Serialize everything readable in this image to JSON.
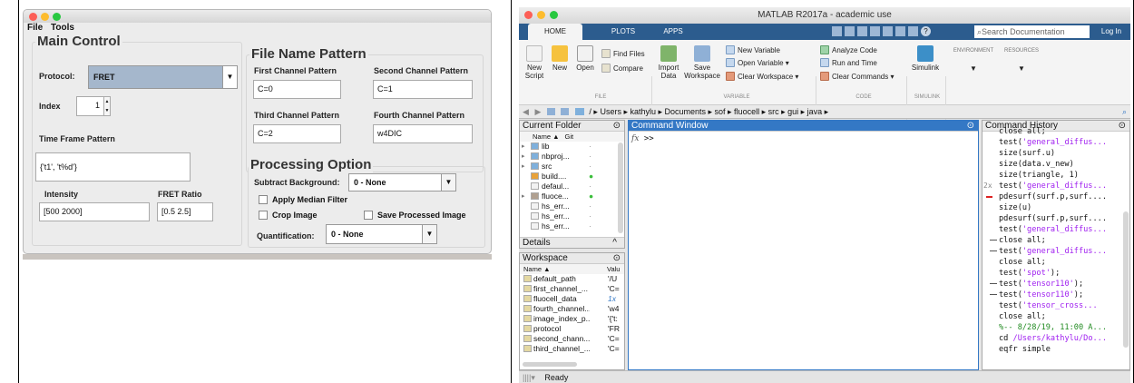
{
  "left_app": {
    "menu": [
      "File",
      "Tools"
    ],
    "main_control": {
      "title": "Main Control",
      "protocol_label": "Protocol:",
      "protocol_value": "FRET",
      "index_label": "Index",
      "index_value": "1",
      "tfp_label": "Time Frame Pattern",
      "tfp_value": "{'t1', 't%d'}",
      "intensity_label": "Intensity",
      "intensity_value": "[500 2000]",
      "fret_label": "FRET Ratio",
      "fret_value": "[0.5 2.5]"
    },
    "file_name_pattern": {
      "title": "File Name Pattern",
      "first_label": "First Channel Pattern",
      "first_value": "C=0",
      "second_label": "Second Channel Pattern",
      "second_value": "C=1",
      "third_label": "Third Channel Pattern",
      "third_value": "C=2",
      "fourth_label": "Fourth Channel Pattern",
      "fourth_value": "w4DIC"
    },
    "processing_option": {
      "title": "Processing Option",
      "subtract_label": "Subtract Background:",
      "subtract_value": "0 - None",
      "median_label": "Apply Median Filter",
      "crop_label": "Crop Image",
      "save_label": "Save Processed Image",
      "quant_label": "Quantification:",
      "quant_value": "0 - None"
    }
  },
  "matlab": {
    "title": "MATLAB R2017a - academic use",
    "tabs": [
      "HOME",
      "PLOTS",
      "APPS"
    ],
    "search_placeholder": "Search Documentation",
    "login": "Log In",
    "ribbon": {
      "new_script": "New\nScript",
      "new": "New",
      "open": "Open",
      "find_files": "Find Files",
      "compare": "Compare",
      "import_data": "Import\nData",
      "save_workspace": "Save\nWorkspace",
      "new_variable": "New Variable",
      "open_variable": "Open Variable ▾",
      "clear_workspace": "Clear Workspace ▾",
      "analyze_code": "Analyze Code",
      "run_and_time": "Run and Time",
      "clear_commands": "Clear Commands ▾",
      "simulink": "Simulink",
      "environment": "ENVIRONMENT",
      "resources": "RESOURCES",
      "sec_file": "FILE",
      "sec_variable": "VARIABLE",
      "sec_code": "CODE",
      "sec_simulink": "SIMULINK"
    },
    "path": "/ ▸ Users ▸ kathylu ▸ Documents ▸ sof ▸ fluocell ▸ src ▸ gui ▸ java ▸",
    "current_folder": {
      "title": "Current Folder",
      "col_name": "Name ▲",
      "col_git": "Git",
      "items": [
        {
          "name": "lib",
          "git": "·",
          "type": "folder"
        },
        {
          "name": "nbproj...",
          "git": "·",
          "type": "folder"
        },
        {
          "name": "src",
          "git": "·",
          "type": "folder"
        },
        {
          "name": "build....",
          "git": "●",
          "type": "xml"
        },
        {
          "name": "defaul...",
          "git": "·",
          "type": "file"
        },
        {
          "name": "fluoce...",
          "git": "●",
          "type": "jar"
        },
        {
          "name": "hs_err...",
          "git": "·",
          "type": "file"
        },
        {
          "name": "hs_err...",
          "git": "·",
          "type": "file"
        },
        {
          "name": "hs_err...",
          "git": "·",
          "type": "file"
        }
      ],
      "details": "Details"
    },
    "workspace": {
      "title": "Workspace",
      "col_name": "Name ▲",
      "col_val": "Valu",
      "items": [
        {
          "name": "default_path",
          "val": "'/U"
        },
        {
          "name": "first_channel_...",
          "val": "'C="
        },
        {
          "name": "fluocell_data",
          "val": "1x"
        },
        {
          "name": "fourth_channel...",
          "val": "'w4"
        },
        {
          "name": "image_index_p...",
          "val": "'{'t:"
        },
        {
          "name": "protocol",
          "val": "'FR"
        },
        {
          "name": "second_chann...",
          "val": "'C="
        },
        {
          "name": "third_channel_...",
          "val": "'C="
        }
      ]
    },
    "command_window": {
      "title": "Command Window",
      "prompt": ">>",
      "fx": "fx"
    },
    "command_history": {
      "title": "Command History",
      "lines": [
        {
          "t": "close all;",
          "mark": ""
        },
        {
          "t": "test('general_diffus...",
          "mark": ""
        },
        {
          "t": "size(surf.u)",
          "mark": ""
        },
        {
          "t": "size(data.v_new)",
          "mark": ""
        },
        {
          "t": "size(triangle, 1)",
          "mark": ""
        },
        {
          "t": "test('general_diffus...",
          "mark": "2x"
        },
        {
          "t": "pdesurf(surf.p,surf....",
          "mark": "err"
        },
        {
          "t": "size(u)",
          "mark": ""
        },
        {
          "t": "pdesurf(surf.p,surf....",
          "mark": ""
        },
        {
          "t": "test('general_diffus...",
          "mark": ""
        },
        {
          "t": "close all;",
          "mark": "br"
        },
        {
          "t": "test('general_diffus...",
          "mark": "br"
        },
        {
          "t": "close all;",
          "mark": ""
        },
        {
          "t": "test('spot');",
          "mark": ""
        },
        {
          "t": "test('tensor110');",
          "mark": "br"
        },
        {
          "t": "test('tensor110');",
          "mark": "br"
        },
        {
          "t": "test('tensor_cross...",
          "mark": ""
        },
        {
          "t": "close all;",
          "mark": ""
        },
        {
          "t": "%-- 8/28/19, 11:00 A...",
          "mark": ""
        },
        {
          "t": "cd /Users/kathylu/Do...",
          "mark": ""
        },
        {
          "t": "eqfr simple",
          "mark": ""
        }
      ]
    },
    "status": "Ready",
    "colors": {
      "tabbar": "#2c5c8e",
      "active_pane": "#3478c5",
      "string": "#a020f0",
      "comment": "#228b22"
    }
  }
}
